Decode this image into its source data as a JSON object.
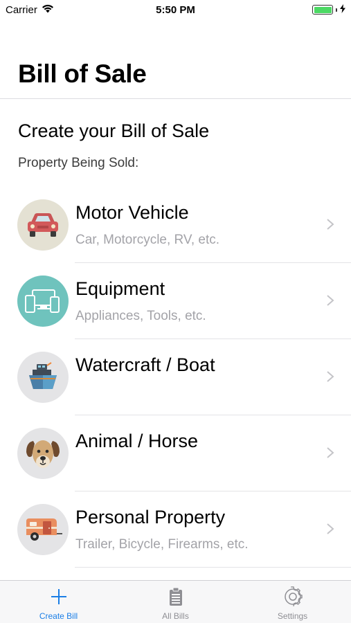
{
  "status_bar": {
    "carrier": "Carrier",
    "time": "5:50 PM",
    "battery_level": 1.0
  },
  "nav": {
    "title": "Bill of Sale"
  },
  "content": {
    "heading": "Create your Bill of Sale",
    "subheading": "Property Being Sold:"
  },
  "items": [
    {
      "title": "Motor Vehicle",
      "subtitle": "Car, Motorcycle, RV, etc.",
      "icon": "car-icon",
      "icon_bg": "#e4e1d3"
    },
    {
      "title": "Equipment",
      "subtitle": "Appliances, Tools, etc.",
      "icon": "devices-icon",
      "icon_bg": "#6fc3bd"
    },
    {
      "title": "Watercraft / Boat",
      "subtitle": "",
      "icon": "boat-icon",
      "icon_bg": "#e4e4e6"
    },
    {
      "title": "Animal / Horse",
      "subtitle": "",
      "icon": "dog-icon",
      "icon_bg": "#e4e4e6"
    },
    {
      "title": "Personal Property",
      "subtitle": "Trailer, Bicycle, Firearms, etc.",
      "icon": "trailer-icon",
      "icon_bg": "#e4e4e6"
    }
  ],
  "tabs": [
    {
      "label": "Create Bill",
      "icon": "plus-icon",
      "active": true
    },
    {
      "label": "All Bills",
      "icon": "clipboard-icon",
      "active": false
    },
    {
      "label": "Settings",
      "icon": "gear-icon",
      "active": false
    }
  ],
  "colors": {
    "accent": "#1a7ee6",
    "inactive": "#8e8e93",
    "subtitle": "#a3a3a8"
  }
}
